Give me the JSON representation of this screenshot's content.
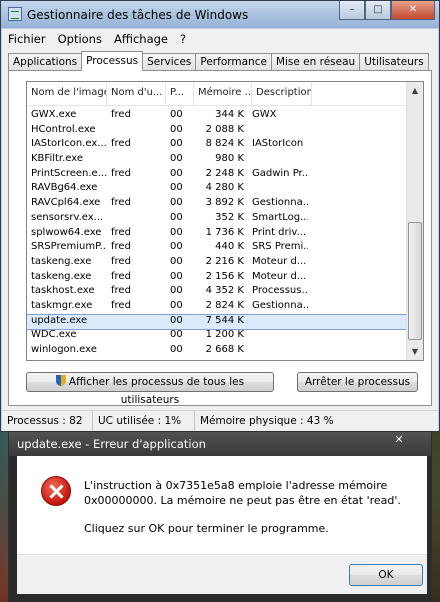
{
  "task_manager": {
    "title": "Gestionnaire des tâches de Windows",
    "menu": [
      "Fichier",
      "Options",
      "Affichage",
      "?"
    ],
    "tabs": [
      "Applications",
      "Processus",
      "Services",
      "Performance",
      "Mise en réseau",
      "Utilisateurs"
    ],
    "active_tab": "Processus",
    "columns": [
      "Nom de l'image",
      "Nom d'u...",
      "P...",
      "Mémoire ...",
      "Description"
    ],
    "processes": [
      {
        "name": "GWX.exe",
        "user": "fred",
        "cpu": "00",
        "mem": "344 K",
        "desc": "GWX"
      },
      {
        "name": "HControl.exe",
        "user": "",
        "cpu": "00",
        "mem": "2 088 K",
        "desc": ""
      },
      {
        "name": "IAStorIcon.ex...",
        "user": "fred",
        "cpu": "00",
        "mem": "8 824 K",
        "desc": "IAStorIcon"
      },
      {
        "name": "KBFiltr.exe",
        "user": "",
        "cpu": "00",
        "mem": "980 K",
        "desc": ""
      },
      {
        "name": "PrintScreen.e...",
        "user": "fred",
        "cpu": "00",
        "mem": "2 248 K",
        "desc": "Gadwin Pr..."
      },
      {
        "name": "RAVBg64.exe",
        "user": "",
        "cpu": "00",
        "mem": "4 280 K",
        "desc": ""
      },
      {
        "name": "RAVCpl64.exe",
        "user": "fred",
        "cpu": "00",
        "mem": "3 892 K",
        "desc": "Gestionna..."
      },
      {
        "name": "sensorsrv.ex...",
        "user": "",
        "cpu": "00",
        "mem": "352 K",
        "desc": "SmartLog..."
      },
      {
        "name": "splwow64.exe",
        "user": "fred",
        "cpu": "00",
        "mem": "1 736 K",
        "desc": "Print driv..."
      },
      {
        "name": "SRSPremiumP...",
        "user": "fred",
        "cpu": "00",
        "mem": "440 K",
        "desc": "SRS Premi..."
      },
      {
        "name": "taskeng.exe",
        "user": "fred",
        "cpu": "00",
        "mem": "2 216 K",
        "desc": "Moteur d..."
      },
      {
        "name": "taskeng.exe",
        "user": "fred",
        "cpu": "00",
        "mem": "2 156 K",
        "desc": "Moteur d..."
      },
      {
        "name": "taskhost.exe",
        "user": "fred",
        "cpu": "00",
        "mem": "4 352 K",
        "desc": "Processus..."
      },
      {
        "name": "taskmgr.exe",
        "user": "fred",
        "cpu": "00",
        "mem": "2 824 K",
        "desc": "Gestionna..."
      },
      {
        "name": "update.exe",
        "user": "",
        "cpu": "00",
        "mem": "7 544 K",
        "desc": "",
        "selected": true
      },
      {
        "name": "WDC.exe",
        "user": "",
        "cpu": "00",
        "mem": "1 200 K",
        "desc": ""
      },
      {
        "name": "winlogon.exe",
        "user": "",
        "cpu": "00",
        "mem": "2 668 K",
        "desc": ""
      }
    ],
    "show_all_button": "Afficher les processus de tous les utilisateurs",
    "end_process_button": "Arrêter le processus",
    "status": {
      "processes": "Processus : 82",
      "cpu": "UC utilisée : 1%",
      "memory": "Mémoire physique : 43 %"
    }
  },
  "error_dialog": {
    "title": "update.exe - Erreur d'application",
    "message": "L'instruction à 0x7351e5a8 emploie l'adresse mémoire 0x00000000. La mémoire ne peut pas être en état 'read'.",
    "hint": "Cliquez sur OK pour terminer le programme.",
    "ok_button": "OK",
    "close_glyph": "✕"
  },
  "colors": {
    "selection": "#dcebfc",
    "error_icon": "#c4160c"
  }
}
